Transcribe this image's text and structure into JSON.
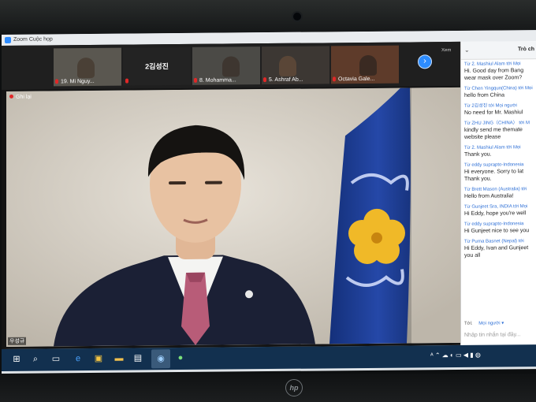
{
  "window": {
    "title": "Zoom Cuộc họp"
  },
  "gallery": {
    "tiles": [
      {
        "name": "19. Mi Nguy..."
      },
      {
        "name": "2김성진",
        "mic_name": ""
      },
      {
        "name": "8. Mohamma..."
      },
      {
        "name": "5. Ashraf Ab..."
      },
      {
        "name": "Octavia Gale..."
      }
    ],
    "view_label": "Xem"
  },
  "speaker": {
    "recording_label": "Ghi lại",
    "name": "우성규"
  },
  "chat": {
    "header": "Trò ch",
    "messages": [
      {
        "from": "Từ 2. Mashiul Alam tới Mọi",
        "lines": [
          "Hi. Good day from Bang",
          "wear mask over Zoom?"
        ]
      },
      {
        "from": "Từ Chen Yingqun(China) tới Mọi",
        "lines": [
          "hello from China"
        ]
      },
      {
        "from": "Từ 2김성진 tới Mọi người",
        "lines": [
          "No need for Mr. Mashiul"
        ]
      },
      {
        "from": "Từ ZHU JING（CHINA） tới M",
        "lines": [
          "kindly send me themate",
          "website please"
        ]
      },
      {
        "from": "Từ 2. Mashiul Alam tới Mọi",
        "lines": [
          "Thank you."
        ]
      },
      {
        "from": "Từ eddy suprapto-Indonesia",
        "lines": [
          "Hi everyone. Sorry to lat",
          "Thank you."
        ]
      },
      {
        "from": "Từ Brett Mason (Australia) tới",
        "lines": [
          "Hello from Australia!"
        ]
      },
      {
        "from": "Từ Gunjeet Sra, INDIA tới Mọi",
        "lines": [
          "Hi Eddy, hope you're well"
        ]
      },
      {
        "from": "Từ eddy suprapto-Indonesia",
        "lines": [
          "Hi Gunjeet nice to see you"
        ]
      },
      {
        "from": "Từ Purna Basnet (Nepal) tới",
        "lines": [
          "Hi Eddy, Ivan and Gunjeet",
          "you all"
        ]
      }
    ],
    "to_label": "Tới:",
    "to_value": "Mọi người ▾",
    "input_placeholder": "Nhập tin nhắn tại đây..."
  },
  "colors": {
    "accent": "#2d8cff",
    "taskbar": "#12304f",
    "flag": "#1f3d8f"
  }
}
